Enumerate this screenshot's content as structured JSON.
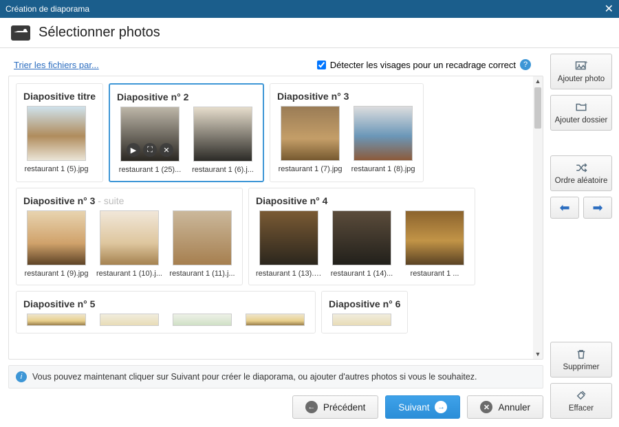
{
  "title": "Création de diaporama",
  "header": "Sélectionner photos",
  "sort_link": "Trier les fichiers par...",
  "detect_label": "Détecter les visages pour un recadrage correct",
  "help_char": "?",
  "hint": "Vous pouvez maintenant cliquer sur Suivant pour créer le diaporama, ou ajouter d'autres photos si vous le souhaitez.",
  "buttons": {
    "prev": "Précédent",
    "next": "Suivant",
    "cancel": "Annuler",
    "add_photo": "Ajouter photo",
    "add_folder": "Ajouter dossier",
    "shuffle": "Ordre aléatoire",
    "delete": "Supprimer",
    "clear": "Effacer"
  },
  "groups": [
    {
      "title": "Diapositive titre",
      "suffix": "",
      "selected": false,
      "thumbs": [
        {
          "label": "restaurant 1 (5).jpg",
          "cls": "p1"
        }
      ]
    },
    {
      "title": "Diapositive n° 2",
      "suffix": "",
      "selected": true,
      "thumbs": [
        {
          "label": "restaurant 1 (25)...",
          "cls": "p2",
          "overlay": true
        },
        {
          "label": "restaurant 1 (6).j...",
          "cls": "p3"
        }
      ]
    },
    {
      "title": "Diapositive n° 3",
      "suffix": "",
      "selected": false,
      "thumbs": [
        {
          "label": "restaurant 1 (7).jpg",
          "cls": "p4"
        },
        {
          "label": "restaurant 1 (8).jpg",
          "cls": "p5"
        }
      ]
    },
    {
      "title": "Diapositive n° 3",
      "suffix": " - suite",
      "selected": false,
      "thumbs": [
        {
          "label": "restaurant 1 (9).jpg",
          "cls": "p6"
        },
        {
          "label": "restaurant 1 (10).j...",
          "cls": "p7"
        },
        {
          "label": "restaurant 1 (11).j...",
          "cls": "p8"
        }
      ]
    },
    {
      "title": "Diapositive n° 4",
      "suffix": "",
      "selected": false,
      "thumbs": [
        {
          "label": "restaurant 1 (13).jpg",
          "cls": "p9"
        },
        {
          "label": "restaurant 1 (14)...",
          "cls": "p10"
        },
        {
          "label": "restaurant 1 ...",
          "cls": "p11"
        }
      ]
    },
    {
      "title": "Diapositive n° 5",
      "suffix": "",
      "selected": false,
      "thumbs": [
        {
          "label": "",
          "cls": "p12"
        },
        {
          "label": "",
          "cls": "p13"
        },
        {
          "label": "",
          "cls": "p14"
        },
        {
          "label": "",
          "cls": "p12"
        }
      ],
      "cut": true
    },
    {
      "title": "Diapositive n° 6",
      "suffix": "",
      "selected": false,
      "thumbs": [
        {
          "label": "",
          "cls": "p13"
        }
      ],
      "cut": true
    }
  ]
}
